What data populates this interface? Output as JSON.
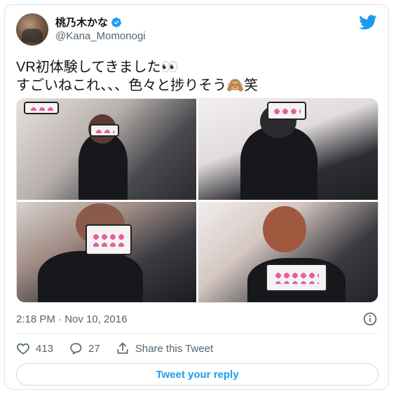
{
  "author": {
    "display_name": "桃乃木かな",
    "handle": "@Kana_Momonogi",
    "verified": true
  },
  "tweet": {
    "text": "VR初体験してきました👀\nすごいねこれ、、、色々と捗りそう🙈笑",
    "timestamp": "2:18 PM · Nov 10, 2016"
  },
  "media": {
    "photo_count": 4
  },
  "stats": {
    "likes": "413",
    "replies": "27",
    "share_label": "Share this Tweet"
  },
  "reply_button": {
    "label": "Tweet your reply"
  },
  "colors": {
    "accent": "#1d9bf0",
    "text_primary": "#0f1419",
    "text_secondary": "#536471"
  },
  "icons": [
    "verified-badge-icon",
    "twitter-bird-icon",
    "info-icon",
    "heart-icon",
    "reply-icon",
    "share-icon"
  ]
}
